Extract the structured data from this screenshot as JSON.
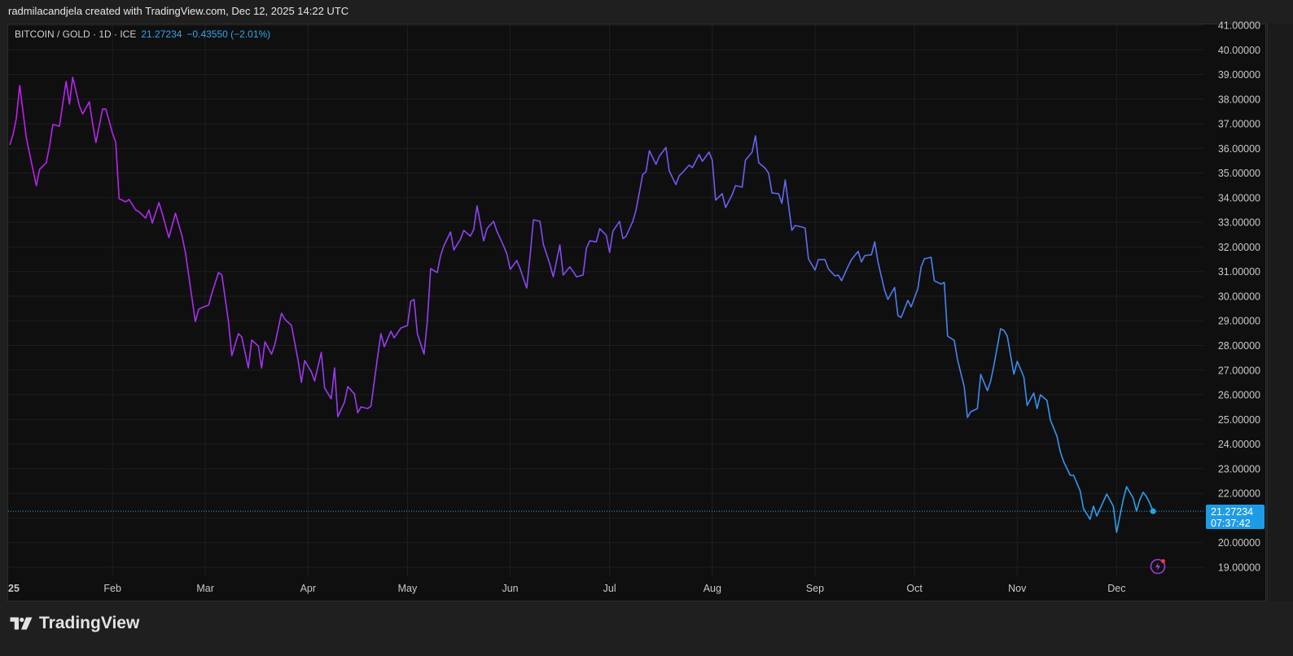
{
  "header": {
    "credit": "radmilacandjela created with TradingView.com, Dec 12, 2025 14:22 UTC"
  },
  "legend": {
    "symbol": "BITCOIN / GOLD · 1D · ICE",
    "last": "21.27234",
    "change": "−0.43550 (−2.01%)"
  },
  "price_tag": {
    "price": "21.27234",
    "countdown": "07:37:42",
    "color": "#1e9be6"
  },
  "footer": {
    "brand": "TradingView"
  },
  "colors": {
    "line_start": "#c01ef0",
    "line_mid": "#7b50f5",
    "line_end": "#22a6ea",
    "background": "#0f0f0f"
  },
  "icons": {
    "alert": "lightning-bolt-icon"
  },
  "chart_data": {
    "type": "line",
    "title": "",
    "xlabel": "",
    "ylabel": "",
    "ylim": [
      18.7,
      41.0
    ],
    "grid": true,
    "y_ticks": [
      "41.00000",
      "40.00000",
      "39.00000",
      "38.00000",
      "37.00000",
      "36.00000",
      "35.00000",
      "34.00000",
      "33.00000",
      "32.00000",
      "31.00000",
      "30.00000",
      "29.00000",
      "28.00000",
      "27.00000",
      "26.00000",
      "25.00000",
      "24.00000",
      "23.00000",
      "22.00000",
      "21.00000",
      "20.00000",
      "19.00000"
    ],
    "x_ticks": [
      {
        "label": "25",
        "date": "2025-01-01"
      },
      {
        "label": "Feb",
        "date": "2025-02-01"
      },
      {
        "label": "Mar",
        "date": "2025-03-01"
      },
      {
        "label": "Apr",
        "date": "2025-04-01"
      },
      {
        "label": "May",
        "date": "2025-05-01"
      },
      {
        "label": "Jun",
        "date": "2025-06-01"
      },
      {
        "label": "Jul",
        "date": "2025-07-01"
      },
      {
        "label": "Aug",
        "date": "2025-08-01"
      },
      {
        "label": "Sep",
        "date": "2025-09-01"
      },
      {
        "label": "Oct",
        "date": "2025-10-01"
      },
      {
        "label": "Nov",
        "date": "2025-11-01"
      },
      {
        "label": "Dec",
        "date": "2025-12-01"
      }
    ],
    "last_value": 21.27234,
    "points": [
      [
        "2025-01-01",
        36.14
      ],
      [
        "2025-01-02",
        36.57
      ],
      [
        "2025-01-03",
        37.23
      ],
      [
        "2025-01-04",
        38.56
      ],
      [
        "2025-01-06",
        36.41
      ],
      [
        "2025-01-09",
        34.49
      ],
      [
        "2025-01-10",
        35.15
      ],
      [
        "2025-01-12",
        35.42
      ],
      [
        "2025-01-13",
        36.08
      ],
      [
        "2025-01-14",
        36.97
      ],
      [
        "2025-01-16",
        36.9
      ],
      [
        "2025-01-18",
        38.72
      ],
      [
        "2025-01-19",
        37.8
      ],
      [
        "2025-01-20",
        38.89
      ],
      [
        "2025-01-22",
        37.73
      ],
      [
        "2025-01-23",
        37.4
      ],
      [
        "2025-01-25",
        37.89
      ],
      [
        "2025-01-26",
        37.0
      ],
      [
        "2025-01-27",
        36.24
      ],
      [
        "2025-01-29",
        37.6
      ],
      [
        "2025-01-30",
        37.6
      ],
      [
        "2025-02-01",
        36.61
      ],
      [
        "2025-02-02",
        36.24
      ],
      [
        "2025-02-03",
        33.96
      ],
      [
        "2025-02-05",
        33.83
      ],
      [
        "2025-02-06",
        33.93
      ],
      [
        "2025-02-08",
        33.5
      ],
      [
        "2025-02-09",
        33.43
      ],
      [
        "2025-02-11",
        33.17
      ],
      [
        "2025-02-12",
        33.5
      ],
      [
        "2025-02-13",
        32.97
      ],
      [
        "2025-02-15",
        33.8
      ],
      [
        "2025-02-16",
        33.37
      ],
      [
        "2025-02-18",
        32.38
      ],
      [
        "2025-02-20",
        33.37
      ],
      [
        "2025-02-22",
        32.44
      ],
      [
        "2025-02-23",
        31.78
      ],
      [
        "2025-02-26",
        28.97
      ],
      [
        "2025-02-27",
        29.47
      ],
      [
        "2025-02-28",
        29.54
      ],
      [
        "2025-03-02",
        29.64
      ],
      [
        "2025-03-03",
        30.13
      ],
      [
        "2025-03-05",
        30.96
      ],
      [
        "2025-03-06",
        30.86
      ],
      [
        "2025-03-08",
        28.97
      ],
      [
        "2025-03-09",
        27.59
      ],
      [
        "2025-03-11",
        28.48
      ],
      [
        "2025-03-12",
        28.35
      ],
      [
        "2025-03-14",
        27.09
      ],
      [
        "2025-03-15",
        28.22
      ],
      [
        "2025-03-17",
        27.98
      ],
      [
        "2025-03-18",
        27.09
      ],
      [
        "2025-03-19",
        28.15
      ],
      [
        "2025-03-21",
        27.65
      ],
      [
        "2025-03-22",
        28.05
      ],
      [
        "2025-03-24",
        29.31
      ],
      [
        "2025-03-25",
        29.07
      ],
      [
        "2025-03-27",
        28.81
      ],
      [
        "2025-03-29",
        27.39
      ],
      [
        "2025-03-30",
        26.5
      ],
      [
        "2025-03-31",
        27.39
      ],
      [
        "2025-04-02",
        26.93
      ],
      [
        "2025-04-03",
        26.56
      ],
      [
        "2025-04-05",
        27.72
      ],
      [
        "2025-04-06",
        26.27
      ],
      [
        "2025-04-08",
        25.84
      ],
      [
        "2025-04-09",
        27.09
      ],
      [
        "2025-04-10",
        25.11
      ],
      [
        "2025-04-12",
        25.7
      ],
      [
        "2025-04-13",
        26.33
      ],
      [
        "2025-04-15",
        26.03
      ],
      [
        "2025-04-16",
        25.27
      ],
      [
        "2025-04-17",
        25.51
      ],
      [
        "2025-04-19",
        25.44
      ],
      [
        "2025-04-20",
        25.54
      ],
      [
        "2025-04-22",
        27.55
      ],
      [
        "2025-04-23",
        28.48
      ],
      [
        "2025-04-24",
        27.95
      ],
      [
        "2025-04-26",
        28.58
      ],
      [
        "2025-04-27",
        28.31
      ],
      [
        "2025-04-29",
        28.71
      ],
      [
        "2025-05-01",
        28.81
      ],
      [
        "2025-05-02",
        29.8
      ],
      [
        "2025-05-03",
        29.87
      ],
      [
        "2025-05-04",
        28.48
      ],
      [
        "2025-05-06",
        27.65
      ],
      [
        "2025-05-07",
        28.97
      ],
      [
        "2025-05-08",
        31.12
      ],
      [
        "2025-05-10",
        30.96
      ],
      [
        "2025-05-11",
        31.65
      ],
      [
        "2025-05-12",
        32.05
      ],
      [
        "2025-05-14",
        32.61
      ],
      [
        "2025-05-15",
        31.88
      ],
      [
        "2025-05-17",
        32.31
      ],
      [
        "2025-05-18",
        32.67
      ],
      [
        "2025-05-20",
        32.44
      ],
      [
        "2025-05-21",
        32.71
      ],
      [
        "2025-05-22",
        33.67
      ],
      [
        "2025-05-24",
        32.25
      ],
      [
        "2025-05-25",
        32.74
      ],
      [
        "2025-05-27",
        33.04
      ],
      [
        "2025-05-28",
        32.64
      ],
      [
        "2025-05-30",
        32.05
      ],
      [
        "2025-05-31",
        31.72
      ],
      [
        "2025-06-01",
        31.09
      ],
      [
        "2025-06-03",
        31.45
      ],
      [
        "2025-06-04",
        31.12
      ],
      [
        "2025-06-06",
        30.33
      ],
      [
        "2025-06-07",
        31.62
      ],
      [
        "2025-06-08",
        33.1
      ],
      [
        "2025-06-10",
        33.04
      ],
      [
        "2025-06-11",
        32.11
      ],
      [
        "2025-06-13",
        31.29
      ],
      [
        "2025-06-14",
        30.79
      ],
      [
        "2025-06-16",
        32.08
      ],
      [
        "2025-06-17",
        30.86
      ],
      [
        "2025-06-19",
        31.19
      ],
      [
        "2025-06-20",
        31.0
      ],
      [
        "2025-06-21",
        30.79
      ],
      [
        "2025-06-23",
        30.86
      ],
      [
        "2025-06-24",
        31.95
      ],
      [
        "2025-06-25",
        32.25
      ],
      [
        "2025-06-27",
        32.21
      ],
      [
        "2025-06-28",
        32.74
      ],
      [
        "2025-06-30",
        32.48
      ],
      [
        "2025-07-01",
        31.78
      ],
      [
        "2025-07-02",
        32.64
      ],
      [
        "2025-07-04",
        33.04
      ],
      [
        "2025-07-05",
        32.34
      ],
      [
        "2025-07-06",
        32.44
      ],
      [
        "2025-07-08",
        33.04
      ],
      [
        "2025-07-09",
        33.5
      ],
      [
        "2025-07-11",
        34.95
      ],
      [
        "2025-07-12",
        35.05
      ],
      [
        "2025-07-13",
        35.91
      ],
      [
        "2025-07-15",
        35.35
      ],
      [
        "2025-07-16",
        35.68
      ],
      [
        "2025-07-18",
        36.04
      ],
      [
        "2025-07-19",
        35.09
      ],
      [
        "2025-07-21",
        34.53
      ],
      [
        "2025-07-22",
        34.89
      ],
      [
        "2025-07-23",
        35.02
      ],
      [
        "2025-07-25",
        35.32
      ],
      [
        "2025-07-26",
        35.22
      ],
      [
        "2025-07-28",
        35.75
      ],
      [
        "2025-07-29",
        35.48
      ],
      [
        "2025-07-31",
        35.85
      ],
      [
        "2025-08-01",
        35.52
      ],
      [
        "2025-08-02",
        33.9
      ],
      [
        "2025-08-04",
        34.16
      ],
      [
        "2025-08-05",
        33.6
      ],
      [
        "2025-08-07",
        34.13
      ],
      [
        "2025-08-08",
        34.49
      ],
      [
        "2025-08-10",
        34.43
      ],
      [
        "2025-08-11",
        35.52
      ],
      [
        "2025-08-13",
        35.85
      ],
      [
        "2025-08-14",
        36.51
      ],
      [
        "2025-08-15",
        35.42
      ],
      [
        "2025-08-17",
        35.19
      ],
      [
        "2025-08-18",
        34.99
      ],
      [
        "2025-08-19",
        34.19
      ],
      [
        "2025-08-21",
        34.16
      ],
      [
        "2025-08-22",
        33.77
      ],
      [
        "2025-08-23",
        34.72
      ],
      [
        "2025-08-25",
        32.67
      ],
      [
        "2025-08-26",
        32.87
      ],
      [
        "2025-08-28",
        32.81
      ],
      [
        "2025-08-29",
        32.77
      ],
      [
        "2025-08-30",
        31.52
      ],
      [
        "2025-09-01",
        31.06
      ],
      [
        "2025-09-02",
        31.49
      ],
      [
        "2025-09-04",
        31.49
      ],
      [
        "2025-09-05",
        31.12
      ],
      [
        "2025-09-07",
        30.82
      ],
      [
        "2025-09-08",
        30.86
      ],
      [
        "2025-09-09",
        30.63
      ],
      [
        "2025-09-11",
        31.22
      ],
      [
        "2025-09-12",
        31.49
      ],
      [
        "2025-09-14",
        31.82
      ],
      [
        "2025-09-15",
        31.39
      ],
      [
        "2025-09-16",
        31.65
      ],
      [
        "2025-09-18",
        31.68
      ],
      [
        "2025-09-19",
        32.21
      ],
      [
        "2025-09-20",
        31.39
      ],
      [
        "2025-09-22",
        30.23
      ],
      [
        "2025-09-23",
        29.87
      ],
      [
        "2025-09-25",
        30.36
      ],
      [
        "2025-09-26",
        29.21
      ],
      [
        "2025-09-27",
        29.14
      ],
      [
        "2025-09-29",
        29.83
      ],
      [
        "2025-09-30",
        29.57
      ],
      [
        "2025-10-02",
        30.3
      ],
      [
        "2025-10-03",
        31.19
      ],
      [
        "2025-10-04",
        31.52
      ],
      [
        "2025-10-06",
        31.58
      ],
      [
        "2025-10-07",
        30.63
      ],
      [
        "2025-10-09",
        30.49
      ],
      [
        "2025-10-10",
        30.56
      ],
      [
        "2025-10-11",
        28.38
      ],
      [
        "2025-10-13",
        28.21
      ],
      [
        "2025-10-14",
        27.42
      ],
      [
        "2025-10-16",
        26.33
      ],
      [
        "2025-10-17",
        25.08
      ],
      [
        "2025-10-18",
        25.31
      ],
      [
        "2025-10-20",
        25.44
      ],
      [
        "2025-10-21",
        26.83
      ],
      [
        "2025-10-23",
        26.17
      ],
      [
        "2025-10-24",
        26.56
      ],
      [
        "2025-10-25",
        27.22
      ],
      [
        "2025-10-27",
        28.68
      ],
      [
        "2025-10-28",
        28.61
      ],
      [
        "2025-10-29",
        28.38
      ],
      [
        "2025-10-31",
        26.83
      ],
      [
        "2025-11-01",
        27.36
      ],
      [
        "2025-11-03",
        26.73
      ],
      [
        "2025-11-04",
        25.57
      ],
      [
        "2025-11-06",
        26.07
      ],
      [
        "2025-11-07",
        25.44
      ],
      [
        "2025-11-08",
        26.0
      ],
      [
        "2025-11-10",
        25.77
      ],
      [
        "2025-11-11",
        24.98
      ],
      [
        "2025-11-13",
        24.32
      ],
      [
        "2025-11-14",
        23.69
      ],
      [
        "2025-11-15",
        23.29
      ],
      [
        "2025-11-17",
        22.73
      ],
      [
        "2025-11-18",
        22.73
      ],
      [
        "2025-11-20",
        22.1
      ],
      [
        "2025-11-21",
        21.38
      ],
      [
        "2025-11-23",
        20.95
      ],
      [
        "2025-11-24",
        21.48
      ],
      [
        "2025-11-25",
        21.08
      ],
      [
        "2025-11-27",
        21.67
      ],
      [
        "2025-11-28",
        21.97
      ],
      [
        "2025-11-30",
        21.48
      ],
      [
        "2025-12-01",
        20.42
      ],
      [
        "2025-12-03",
        21.74
      ],
      [
        "2025-12-04",
        22.27
      ],
      [
        "2025-12-06",
        21.81
      ],
      [
        "2025-12-07",
        21.28
      ],
      [
        "2025-12-08",
        21.74
      ],
      [
        "2025-12-09",
        22.04
      ],
      [
        "2025-12-10",
        21.87
      ],
      [
        "2025-12-11",
        21.6
      ],
      [
        "2025-12-12",
        21.27234
      ]
    ]
  }
}
